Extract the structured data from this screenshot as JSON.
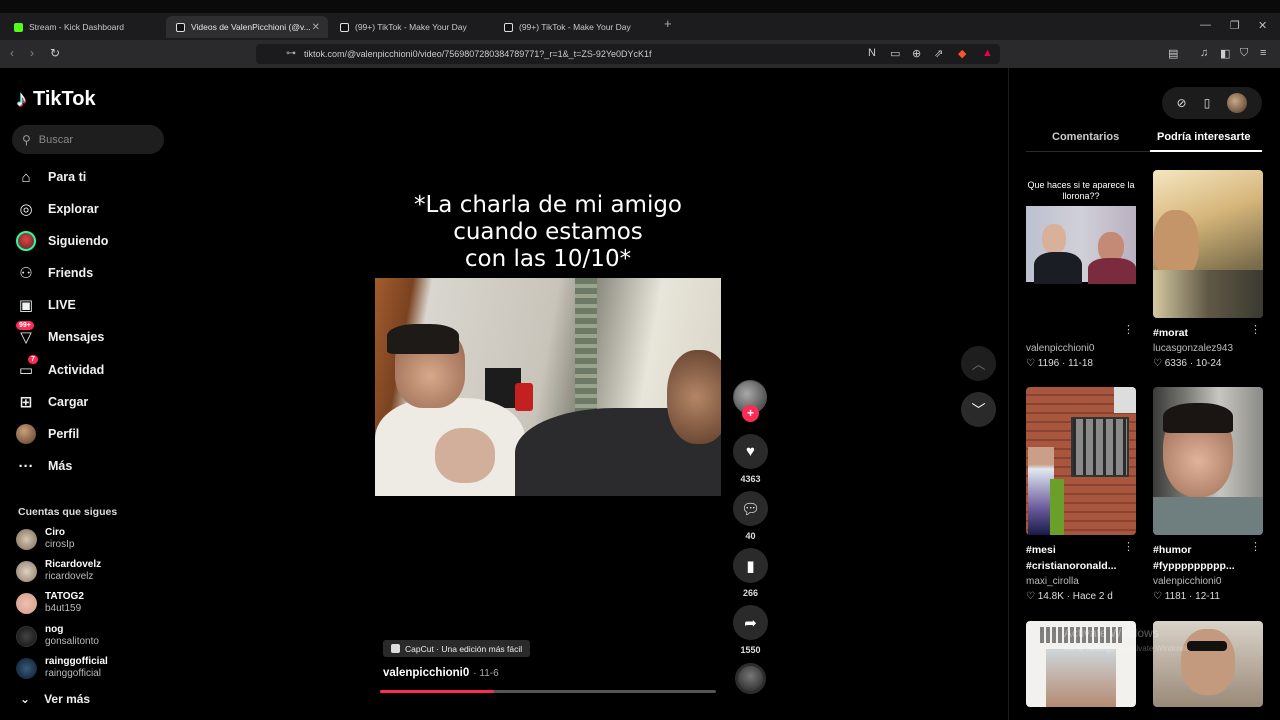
{
  "browser": {
    "tabs": [
      {
        "title": "Stream - Kick Dashboard",
        "favicon_color": "#53fc18"
      },
      {
        "title": "Videos de ValenPicchioni (@v...",
        "favicon_color": "#111111"
      },
      {
        "title": "(99+) TikTok - Make Your Day",
        "favicon_color": "#111111"
      },
      {
        "title": "(99+) TikTok - Make Your Day",
        "favicon_color": "#111111"
      }
    ],
    "new_tab": "+",
    "url": "tiktok.com/@valenpicchioni0/video/7569807280384789771?_r=1&_t=ZS-92Ye0DYcK1f"
  },
  "sidebar": {
    "logo": "TikTok",
    "search_placeholder": "Buscar",
    "nav": [
      {
        "label": "Para ti",
        "icon": "home-icon",
        "glyph": "⌂"
      },
      {
        "label": "Explorar",
        "icon": "compass-icon",
        "glyph": "◎"
      },
      {
        "label": "Siguiendo",
        "icon": "following-avatar-icon",
        "glyph": ""
      },
      {
        "label": "Friends",
        "icon": "friends-icon",
        "glyph": "👥"
      },
      {
        "label": "LIVE",
        "icon": "live-icon",
        "glyph": "▣"
      },
      {
        "label": "Mensajes",
        "icon": "messages-icon",
        "glyph": "✉",
        "badge": "99+"
      },
      {
        "label": "Actividad",
        "icon": "activity-icon",
        "glyph": "▭",
        "badge": "7"
      },
      {
        "label": "Cargar",
        "icon": "upload-icon",
        "glyph": "⊞"
      },
      {
        "label": "Perfil",
        "icon": "profile-avatar-icon",
        "glyph": ""
      },
      {
        "label": "Más",
        "icon": "more-icon",
        "glyph": "···"
      }
    ],
    "following_title": "Cuentas que sigues",
    "accounts": [
      {
        "name": "Ciro",
        "handle": "cirosIp",
        "color": "#7a6a5a"
      },
      {
        "name": "Ricardovelz",
        "handle": "ricardovelz",
        "color": "#8a7a6a"
      },
      {
        "name": "TATOG2",
        "handle": "b4ut159",
        "color": "#d09a8a"
      },
      {
        "name": "nog",
        "handle": "gonsalitonto",
        "color": "#222222"
      },
      {
        "name": "rainggofficial",
        "handle": "rainggofficial",
        "color": "#1a2a3a"
      }
    ],
    "see_more": "Ver más"
  },
  "video": {
    "caption_lines": [
      "*La charla de mi amigo",
      "cuando estamos",
      "con las 10/10*"
    ],
    "capcut_label": "CapCut · Una edición más fácil",
    "author": "valenpicchioni0",
    "date": "· 11-6",
    "progress": 0.34,
    "likes": "4363",
    "comments": "40",
    "saves": "266",
    "shares": "1550"
  },
  "right_panel": {
    "tab_comments": "Comentarios",
    "tab_suggested": "Podría interesarte",
    "cards": [
      {
        "overlay": "Que haces si te aparece la llorona??",
        "tag": "",
        "user": "valenpicchioni0",
        "stats": "♡ 1196 · 11-18"
      },
      {
        "overlay": "",
        "tag": "#morat",
        "user": "lucasgonzalez943",
        "stats": "♡ 6336 · 10-24"
      },
      {
        "overlay": "",
        "tag": "#mesi #cristianoronald...",
        "user": "maxi_cirolla",
        "stats": "♡ 14.8K · Hace 2 d"
      },
      {
        "overlay": "",
        "tag": "#humor #fyppppppppp...",
        "user": "valenpicchioni0",
        "stats": "♡ 1181 · 12-11"
      },
      {
        "overlay": "",
        "tag": "",
        "user": "",
        "stats": ""
      },
      {
        "overlay": "",
        "tag": "",
        "user": "",
        "stats": ""
      }
    ]
  },
  "watermark": {
    "line1": "Activate Windows",
    "line2": "Go to Settings to activate Windows."
  }
}
